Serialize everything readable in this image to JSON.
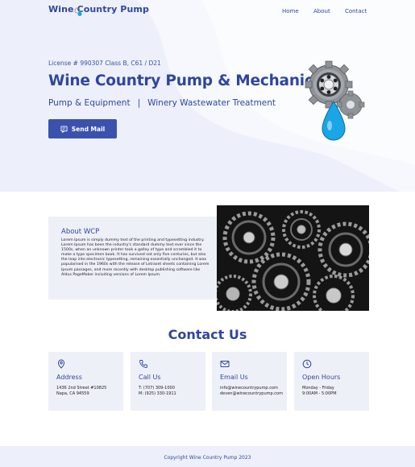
{
  "header": {
    "logo_text": "Wine Country Pump",
    "nav": [
      {
        "label": "Home"
      },
      {
        "label": "About"
      },
      {
        "label": "Contact"
      }
    ]
  },
  "hero": {
    "license": "License # 990307 Class B, C61 / D21",
    "title": "Wine Country Pump & Mechanical",
    "subtitle_left": "Pump & Equipment",
    "subtitle_separator": "|",
    "subtitle_right": "Winery Wastewater Treatment",
    "cta_label": "Send Mail",
    "graphic_icons": [
      "gear-icon",
      "bearing-icon",
      "water-drop-icon"
    ]
  },
  "about": {
    "title": "About WCP",
    "text": "Lorem Ipsum is simply dummy text of the printing and typesetting industry. Lorem Ipsum has been the industry's standard dummy text ever since the 1500s, when an unknown printer took a galley of type and scrambled it to make a type specimen book. It has survived not only five centuries, but also the leap into electronic typesetting, remaining essentially unchanged. It was popularised in the 1960s with the release of Letraset sheets containing Lorem Ipsum passages, and more recently with desktop publishing software like Aldus PageMaker including versions of Lorem Ipsum."
  },
  "contact": {
    "heading": "Contact Us",
    "cards": [
      {
        "icon": "location-pin-icon",
        "title": "Address",
        "line1": "1436 2nd Street #10825",
        "line2": "Napa, CA 94559"
      },
      {
        "icon": "phone-icon",
        "title": "Call Us",
        "line1": "T: (707) 309-1000",
        "line2": "M: (925) 330-1911"
      },
      {
        "icon": "mail-icon",
        "title": "Email Us",
        "line1": "info@winecountrypump.com",
        "line2": "deven@winecountrypump.com"
      },
      {
        "icon": "clock-icon",
        "title": "Open Hours",
        "line1": "Monday - Friday",
        "line2": "9:00AM - 5:00PM"
      }
    ]
  },
  "footer": {
    "copyright": "Copyright Wine Country Pump 2023"
  },
  "colors": {
    "brand": "#2f46a0",
    "button": "#3b52ad",
    "hero_bg": "#edf0fa",
    "card_bg": "#eef0f8",
    "drop": "#1aa6e6"
  }
}
